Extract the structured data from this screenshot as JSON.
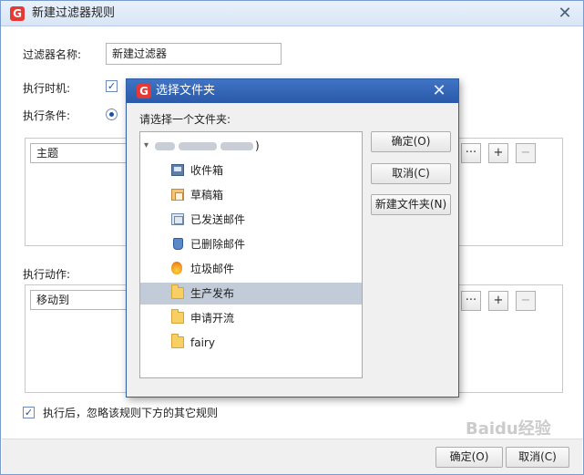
{
  "outer": {
    "logo": "G",
    "title": "新建过滤器规则",
    "close_glyph": "✕",
    "filter_name_label": "过滤器名称:",
    "filter_name_value": "新建过滤器",
    "exec_time_label": "执行时机:",
    "exec_cond_label": "执行条件:",
    "condition_field": "主题",
    "action_label": "执行动作:",
    "action_field": "移动到",
    "more_glyph": "···",
    "add_glyph": "+",
    "remove_glyph": "−",
    "checkbox_glyph": "✓",
    "ignore_rules_label": "执行后，忽略该规则下方的其它规则",
    "ok_button": "确定(O)",
    "cancel_button": "取消(C)",
    "watermark": "Baidu经验"
  },
  "modal": {
    "logo": "G",
    "title": "选择文件夹",
    "close_glyph": "✕",
    "prompt": "请选择一个文件夹:",
    "root_suffix": ")",
    "expand_glyph": "▾",
    "folders": [
      {
        "label": "收件箱",
        "icon": "inbox-icon",
        "selected": false
      },
      {
        "label": "草稿箱",
        "icon": "drafts-icon",
        "selected": false
      },
      {
        "label": "已发送邮件",
        "icon": "sent-icon",
        "selected": false
      },
      {
        "label": "已删除邮件",
        "icon": "trash-icon",
        "selected": false
      },
      {
        "label": "垃圾邮件",
        "icon": "junk-icon",
        "selected": false
      },
      {
        "label": "生产发布",
        "icon": "folder-icon",
        "selected": true
      },
      {
        "label": "申请开流",
        "icon": "folder-icon",
        "selected": false
      },
      {
        "label": "fairy",
        "icon": "folder-icon",
        "selected": false
      }
    ],
    "ok_button": "确定(O)",
    "cancel_button": "取消(C)",
    "new_folder_button": "新建文件夹(N)"
  }
}
